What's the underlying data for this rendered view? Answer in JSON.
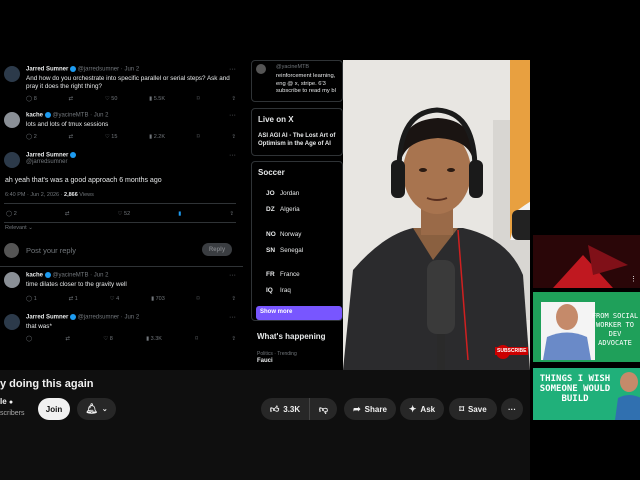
{
  "tweets": [
    {
      "author": "Jarred Sumner",
      "handle": "@jarredsumner · Jun 2",
      "text": "And how do you orchestrate into specific parallel or serial steps? Ask and pray it does the right thing?",
      "replies": "8",
      "likes": "50",
      "views": "5.5K"
    },
    {
      "author": "kache",
      "handle": "@yacineMTB · Jun 2",
      "text": "lots and lots of tmux sessions",
      "replies": "2",
      "likes": "15",
      "views": "2.2K"
    },
    {
      "author": "Jarred Sumner",
      "handle": "@jarredsumner",
      "text": "ah yeah that's was a good approach 6 months ago",
      "meta_time": "6:40 PM · Jun 2, 2026 · ",
      "meta_views": "2,866",
      "meta_views_label": " Views",
      "replies": "2",
      "likes": "52"
    },
    {
      "author": "kache",
      "handle": "@yacineMTB · Jun 2",
      "text": "time dilates closer to the gravity well",
      "replies": "1",
      "retweets": "1",
      "likes": "4",
      "views": "703"
    },
    {
      "author": "Jarred Sumner",
      "handle": "@jarredsumner · Jun 2",
      "text": "that was*",
      "likes": "8",
      "views": "3.3K"
    }
  ],
  "relevant_label": "Relevant",
  "reply_placeholder": "Post your reply",
  "reply_button": "Reply",
  "side": {
    "handle": "@yacineMTB",
    "snippet": "reinforcement learning, eng @ x, stripe. 6'3 subscribe to read my bl",
    "live_title": "Live on X",
    "live_text": "ASI AGI AI - The Lost Art of Optimism in the Age of AI",
    "soccer_title": "Soccer",
    "matches": [
      [
        {
          "code": "JO",
          "name": "Jordan"
        },
        {
          "code": "DZ",
          "name": "Algeria"
        }
      ],
      [
        {
          "code": "NO",
          "name": "Norway"
        },
        {
          "code": "SN",
          "name": "Senegal"
        }
      ],
      [
        {
          "code": "FR",
          "name": "France"
        },
        {
          "code": "IQ",
          "name": "Iraq"
        }
      ]
    ],
    "show_more": "Show more",
    "happening_title": "What's happening",
    "trend_meta": "Politics · Trending",
    "trend_name": "Fauci"
  },
  "video": {
    "title": "y doing this again",
    "channel": "le",
    "subscribers": "scribers",
    "join": "Join",
    "likes": "3.3K",
    "share": "Share",
    "ask": "Ask",
    "save": "Save",
    "subscribe_badge": "SUBSCRIBE"
  },
  "recommended": [
    {
      "text": "",
      "bg": "#3a0a10"
    },
    {
      "text": "FROM SOCIAL WORKER TO DEV ADVOCATE",
      "bg": "#1f9d55"
    },
    {
      "text": "THINGS I WISH SOMEONE WOULD BUILD",
      "bg": "#20b07a"
    }
  ],
  "colors": {
    "accent": "#1d9bf0",
    "live_bar": "#ff0000",
    "show_more": "#7856ff"
  }
}
